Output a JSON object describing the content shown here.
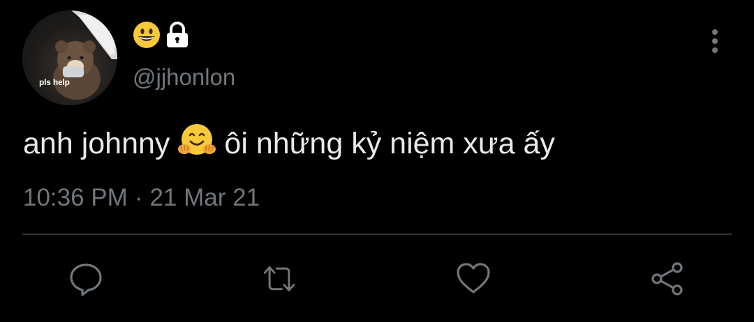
{
  "profile": {
    "avatar_caption": "pls help",
    "handle": "@jjhonlon",
    "name_icons": [
      "grinning-face-emoji",
      "lock-icon"
    ]
  },
  "tweet": {
    "text_before": "anh johnny",
    "emoji": "hugging-face-emoji",
    "text_after": "ôi những kỷ niệm xưa ấy",
    "time": "10:36 PM",
    "separator": "·",
    "date": "21 Mar 21"
  },
  "actions": [
    "reply-icon",
    "retweet-icon",
    "like-icon",
    "share-icon"
  ],
  "colors": {
    "background": "#000000",
    "text": "#e7e9ea",
    "secondary_text": "#71767b",
    "divider": "#2f3336"
  }
}
